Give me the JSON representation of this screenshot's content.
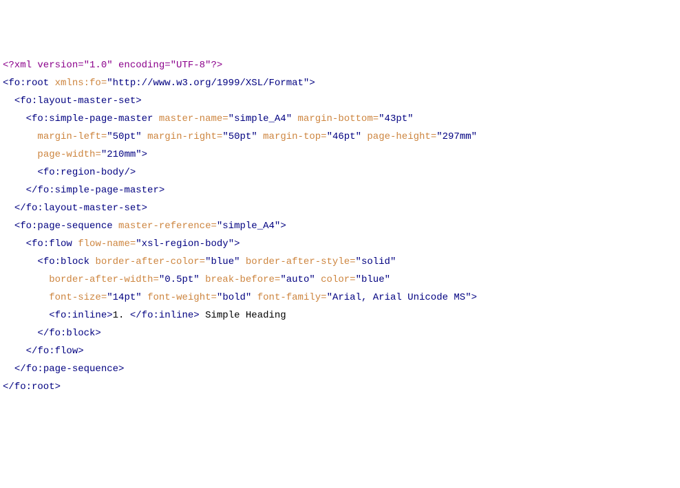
{
  "lines": [
    {
      "indent": 0,
      "parts": [
        {
          "c": "xml-decl",
          "t": "<?xml version=\"1.0\" encoding=\"UTF-8\"?>"
        }
      ]
    },
    {
      "indent": 0,
      "parts": [
        {
          "c": "tag",
          "t": "<fo:root "
        },
        {
          "c": "attr-name",
          "t": "xmlns:fo"
        },
        {
          "c": "eq",
          "t": "="
        },
        {
          "c": "quote",
          "t": "\""
        },
        {
          "c": "attr-val",
          "t": "http://www.w3.org/1999/XSL/Format"
        },
        {
          "c": "quote",
          "t": "\""
        },
        {
          "c": "tag",
          "t": ">"
        }
      ]
    },
    {
      "indent": 1,
      "parts": [
        {
          "c": "tag",
          "t": "<fo:layout-master-set>"
        }
      ]
    },
    {
      "indent": 2,
      "parts": [
        {
          "c": "tag",
          "t": "<fo:simple-page-master "
        },
        {
          "c": "attr-name",
          "t": "master-name"
        },
        {
          "c": "eq",
          "t": "="
        },
        {
          "c": "quote",
          "t": "\""
        },
        {
          "c": "attr-val",
          "t": "simple_A4"
        },
        {
          "c": "quote",
          "t": "\" "
        },
        {
          "c": "attr-name",
          "t": "margin-bottom"
        },
        {
          "c": "eq",
          "t": "="
        },
        {
          "c": "quote",
          "t": "\""
        },
        {
          "c": "attr-val",
          "t": "43pt"
        },
        {
          "c": "quote",
          "t": "\""
        }
      ]
    },
    {
      "indent": 3,
      "parts": [
        {
          "c": "attr-name",
          "t": "margin-left"
        },
        {
          "c": "eq",
          "t": "="
        },
        {
          "c": "quote",
          "t": "\""
        },
        {
          "c": "attr-val",
          "t": "50pt"
        },
        {
          "c": "quote",
          "t": "\" "
        },
        {
          "c": "attr-name",
          "t": "margin-right"
        },
        {
          "c": "eq",
          "t": "="
        },
        {
          "c": "quote",
          "t": "\""
        },
        {
          "c": "attr-val",
          "t": "50pt"
        },
        {
          "c": "quote",
          "t": "\" "
        },
        {
          "c": "attr-name",
          "t": "margin-top"
        },
        {
          "c": "eq",
          "t": "="
        },
        {
          "c": "quote",
          "t": "\""
        },
        {
          "c": "attr-val",
          "t": "46pt"
        },
        {
          "c": "quote",
          "t": "\" "
        },
        {
          "c": "attr-name",
          "t": "page-height"
        },
        {
          "c": "eq",
          "t": "="
        },
        {
          "c": "quote",
          "t": "\""
        },
        {
          "c": "attr-val",
          "t": "297mm"
        },
        {
          "c": "quote",
          "t": "\""
        }
      ]
    },
    {
      "indent": 3,
      "parts": [
        {
          "c": "attr-name",
          "t": "page-width"
        },
        {
          "c": "eq",
          "t": "="
        },
        {
          "c": "quote",
          "t": "\""
        },
        {
          "c": "attr-val",
          "t": "210mm"
        },
        {
          "c": "quote",
          "t": "\""
        },
        {
          "c": "tag",
          "t": ">"
        }
      ]
    },
    {
      "indent": 3,
      "parts": [
        {
          "c": "tag",
          "t": "<fo:region-body/>"
        }
      ]
    },
    {
      "indent": 2,
      "parts": [
        {
          "c": "tag",
          "t": "</fo:simple-page-master>"
        }
      ]
    },
    {
      "indent": 1,
      "parts": [
        {
          "c": "tag",
          "t": "</fo:layout-master-set>"
        }
      ]
    },
    {
      "indent": 1,
      "parts": [
        {
          "c": "tag",
          "t": "<fo:page-sequence "
        },
        {
          "c": "attr-name",
          "t": "master-reference"
        },
        {
          "c": "eq",
          "t": "="
        },
        {
          "c": "quote",
          "t": "\""
        },
        {
          "c": "attr-val",
          "t": "simple_A4"
        },
        {
          "c": "quote",
          "t": "\""
        },
        {
          "c": "tag",
          "t": ">"
        }
      ]
    },
    {
      "indent": 2,
      "parts": [
        {
          "c": "tag",
          "t": "<fo:flow "
        },
        {
          "c": "attr-name",
          "t": "flow-name"
        },
        {
          "c": "eq",
          "t": "="
        },
        {
          "c": "quote",
          "t": "\""
        },
        {
          "c": "attr-val",
          "t": "xsl-region-body"
        },
        {
          "c": "quote",
          "t": "\""
        },
        {
          "c": "tag",
          "t": ">"
        }
      ]
    },
    {
      "indent": 3,
      "parts": [
        {
          "c": "tag",
          "t": "<fo:block "
        },
        {
          "c": "attr-name",
          "t": "border-after-color"
        },
        {
          "c": "eq",
          "t": "="
        },
        {
          "c": "quote",
          "t": "\""
        },
        {
          "c": "attr-val",
          "t": "blue"
        },
        {
          "c": "quote",
          "t": "\" "
        },
        {
          "c": "attr-name",
          "t": "border-after-style"
        },
        {
          "c": "eq",
          "t": "="
        },
        {
          "c": "quote",
          "t": "\""
        },
        {
          "c": "attr-val",
          "t": "solid"
        },
        {
          "c": "quote",
          "t": "\""
        }
      ]
    },
    {
      "indent": 4,
      "parts": [
        {
          "c": "attr-name",
          "t": "border-after-width"
        },
        {
          "c": "eq",
          "t": "="
        },
        {
          "c": "quote",
          "t": "\""
        },
        {
          "c": "attr-val",
          "t": "0.5pt"
        },
        {
          "c": "quote",
          "t": "\" "
        },
        {
          "c": "attr-name",
          "t": "break-before"
        },
        {
          "c": "eq",
          "t": "="
        },
        {
          "c": "quote",
          "t": "\""
        },
        {
          "c": "attr-val",
          "t": "auto"
        },
        {
          "c": "quote",
          "t": "\" "
        },
        {
          "c": "attr-name",
          "t": "color"
        },
        {
          "c": "eq",
          "t": "="
        },
        {
          "c": "quote",
          "t": "\""
        },
        {
          "c": "attr-val",
          "t": "blue"
        },
        {
          "c": "quote",
          "t": "\""
        }
      ]
    },
    {
      "indent": 4,
      "parts": [
        {
          "c": "attr-name",
          "t": "font-size"
        },
        {
          "c": "eq",
          "t": "="
        },
        {
          "c": "quote",
          "t": "\""
        },
        {
          "c": "attr-val",
          "t": "14pt"
        },
        {
          "c": "quote",
          "t": "\" "
        },
        {
          "c": "attr-name",
          "t": "font-weight"
        },
        {
          "c": "eq",
          "t": "="
        },
        {
          "c": "quote",
          "t": "\""
        },
        {
          "c": "attr-val",
          "t": "bold"
        },
        {
          "c": "quote",
          "t": "\" "
        },
        {
          "c": "attr-name",
          "t": "font-family"
        },
        {
          "c": "eq",
          "t": "="
        },
        {
          "c": "quote",
          "t": "\""
        },
        {
          "c": "attr-val",
          "t": "Arial, Arial Unicode MS"
        },
        {
          "c": "quote",
          "t": "\""
        },
        {
          "c": "tag",
          "t": ">"
        }
      ]
    },
    {
      "indent": 4,
      "parts": [
        {
          "c": "tag",
          "t": "<fo:inline>"
        },
        {
          "c": "text",
          "t": "1. "
        },
        {
          "c": "tag",
          "t": "</fo:inline>"
        },
        {
          "c": "text",
          "t": " Simple Heading"
        }
      ]
    },
    {
      "indent": 3,
      "parts": [
        {
          "c": "tag",
          "t": "</fo:block>"
        }
      ]
    },
    {
      "indent": 2,
      "parts": [
        {
          "c": "tag",
          "t": "</fo:flow>"
        }
      ]
    },
    {
      "indent": 1,
      "parts": [
        {
          "c": "tag",
          "t": "</fo:page-sequence>"
        }
      ]
    },
    {
      "indent": 0,
      "parts": [
        {
          "c": "tag",
          "t": "</fo:root>"
        }
      ]
    }
  ],
  "indentUnit": "  "
}
